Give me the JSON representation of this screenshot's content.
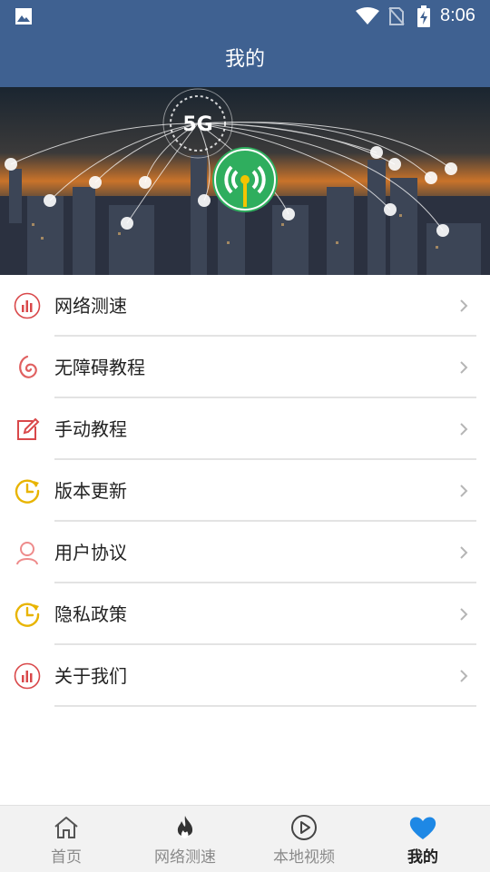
{
  "status_bar": {
    "time": "8:06"
  },
  "header": {
    "title": "我的"
  },
  "hero": {
    "badge": "5G"
  },
  "menu": [
    {
      "label": "网络测速",
      "icon": "bar-chart-icon",
      "color": "#d9484a"
    },
    {
      "label": "无障碍教程",
      "icon": "swirl-icon",
      "color": "#e06060"
    },
    {
      "label": "手动教程",
      "icon": "edit-icon",
      "color": "#d9484a"
    },
    {
      "label": "版本更新",
      "icon": "clock-refresh-icon",
      "color": "#e8b400"
    },
    {
      "label": "用户协议",
      "icon": "user-icon",
      "color": "#ee8b8b"
    },
    {
      "label": "隐私政策",
      "icon": "clock-refresh-icon",
      "color": "#e8b400"
    },
    {
      "label": "关于我们",
      "icon": "bar-chart-icon",
      "color": "#d9484a"
    }
  ],
  "tabs": [
    {
      "label": "首页",
      "icon": "home-icon"
    },
    {
      "label": "网络测速",
      "icon": "flame-icon"
    },
    {
      "label": "本地视频",
      "icon": "play-circle-icon"
    },
    {
      "label": "我的",
      "icon": "heart-icon",
      "active": true
    }
  ],
  "colors": {
    "primary": "#3f6191",
    "active_tab": "#1e88e5"
  }
}
